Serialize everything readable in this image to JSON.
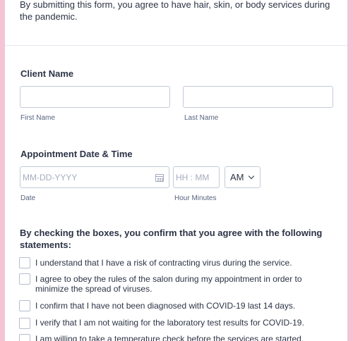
{
  "intro_text": "By submitting this form, you agree to have hair, skin, or body services during the pandemic.",
  "client_name": {
    "label": "Client Name",
    "first_label": "First Name",
    "last_label": "Last Name",
    "first_value": "",
    "last_value": ""
  },
  "appointment": {
    "label": "Appointment Date & Time",
    "date_placeholder": "MM-DD-YYYY",
    "date_sublabel": "Date",
    "time_placeholder": "HH : MM",
    "time_sublabel": "Hour Minutes",
    "ampm_value": "AM"
  },
  "statements": {
    "title": "By checking the boxes, you confirm that you agree with the following statements:",
    "items": [
      "I understand that I have a risk of contracting virus during the service.",
      "I agree to obey the rules of the salon during my appointment in order to minimize the spread of viruses.",
      "I confirm that I have not been diagnosed with COVID-19 last 14 days.",
      "I verify that I am not waiting for the laboratory test results for COVID-19.",
      "I am willing to take a temperature check before the services are started."
    ]
  },
  "colors": {
    "page_background": "#f4c4d6",
    "card_background": "#ffffff",
    "text": "#2c3345",
    "border": "#c3cad8"
  }
}
